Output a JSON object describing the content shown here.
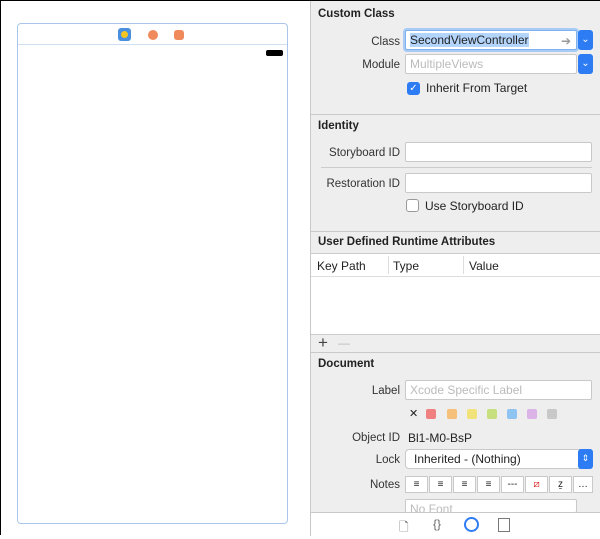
{
  "canvas": {
    "icons": [
      "view-controller-icon",
      "first-responder-icon",
      "exit-icon"
    ]
  },
  "custom_class": {
    "title": "Custom Class",
    "class_label": "Class",
    "class_value": "SecondViewController",
    "module_label": "Module",
    "module_placeholder": "MultipleViews",
    "inherit_label": "Inherit From Target",
    "inherit_checked": true
  },
  "identity": {
    "title": "Identity",
    "storyboard_id_label": "Storyboard ID",
    "restoration_id_label": "Restoration ID",
    "use_storyboard_id_label": "Use Storyboard ID",
    "use_storyboard_id_checked": false
  },
  "runtime_attrs": {
    "title": "User Defined Runtime Attributes",
    "columns": [
      "Key Path",
      "Type",
      "Value"
    ],
    "add": "+",
    "remove": "—"
  },
  "document": {
    "title": "Document",
    "label_label": "Label",
    "label_placeholder": "Xcode Specific Label",
    "clear": "✕",
    "colors": [
      "#f08080",
      "#f5c07a",
      "#f2e27a",
      "#c7df7e",
      "#8fc3f2",
      "#dcb3e6",
      "#c8c8c8"
    ],
    "object_id_label": "Object ID",
    "object_id": "Bl1-M0-BsP",
    "lock_label": "Lock",
    "lock_value": "Inherited - (Nothing)",
    "notes_label": "Notes",
    "notes_font_placeholder": "No Font",
    "notes_buttons": [
      "align-left",
      "align-center",
      "align-right",
      "justify",
      "---",
      "no-color",
      "no-text-color",
      "more"
    ]
  },
  "bottom_tabs": [
    "file-inspector",
    "quick-help",
    "identity-inspector",
    "library"
  ],
  "accent": "#2d7cf3"
}
